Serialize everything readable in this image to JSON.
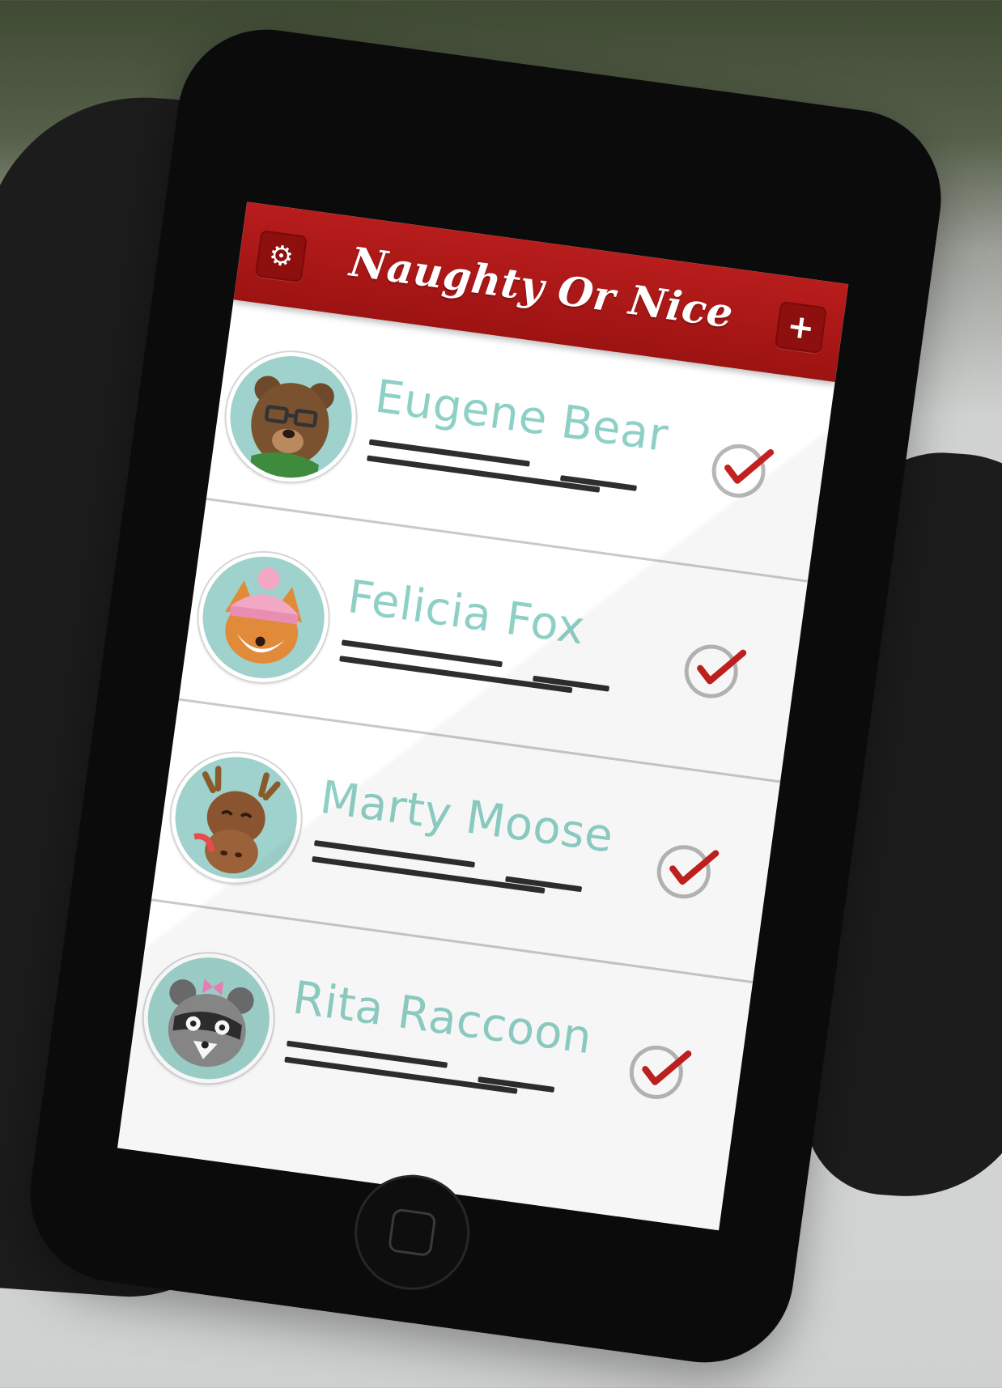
{
  "app": {
    "title": "Naughty Or Nice",
    "settings_icon": "gear-icon",
    "settings_glyph": "⚙",
    "add_icon": "plus-icon",
    "add_glyph": "+"
  },
  "colors": {
    "header_red": "#b81d1c",
    "name_teal": "#8ed0c6",
    "check_red": "#c3201f",
    "avatar_bg": "#9fd2cc"
  },
  "people": [
    {
      "name": "Eugene Bear",
      "avatar_icon": "bear-avatar-icon",
      "checked": true
    },
    {
      "name": "Felicia Fox",
      "avatar_icon": "fox-avatar-icon",
      "checked": true
    },
    {
      "name": "Marty Moose",
      "avatar_icon": "moose-avatar-icon",
      "checked": true
    },
    {
      "name": "Rita Raccoon",
      "avatar_icon": "raccoon-avatar-icon",
      "checked": true
    }
  ]
}
